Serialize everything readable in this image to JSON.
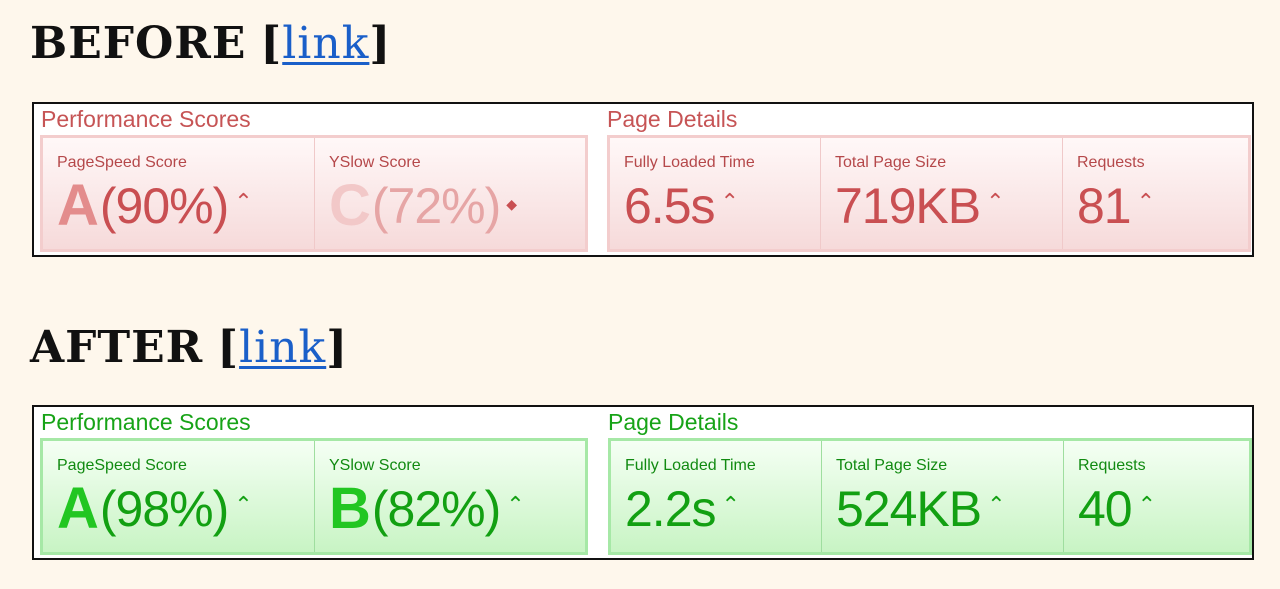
{
  "before": {
    "heading": "BEFORE",
    "link": "link",
    "performance_title": "Performance Scores",
    "details_title": "Page Details",
    "pagespeed": {
      "label": "PageSpeed Score",
      "grade": "A",
      "percent": "(90%)",
      "arrow": "⌃"
    },
    "yslow": {
      "label": "YSlow Score",
      "grade": "C",
      "percent": "(72%)",
      "arrow": "◆"
    },
    "loaded": {
      "label": "Fully Loaded Time",
      "value": "6.5s",
      "arrow": "⌃"
    },
    "size": {
      "label": "Total Page Size",
      "value": "719KB",
      "arrow": "⌃"
    },
    "requests": {
      "label": "Requests",
      "value": "81",
      "arrow": "⌃"
    },
    "colors": {
      "title": "#c65455",
      "value": "#c94f52"
    }
  },
  "after": {
    "heading": "AFTER",
    "link": "link",
    "performance_title": "Performance Scores",
    "details_title": "Page Details",
    "pagespeed": {
      "label": "PageSpeed Score",
      "grade": "A",
      "percent": "(98%)",
      "arrow": "⌃"
    },
    "yslow": {
      "label": "YSlow Score",
      "grade": "B",
      "percent": "(82%)",
      "arrow": "⌃"
    },
    "loaded": {
      "label": "Fully Loaded Time",
      "value": "2.2s",
      "arrow": "⌃"
    },
    "size": {
      "label": "Total Page Size",
      "value": "524KB",
      "arrow": "⌃"
    },
    "requests": {
      "label": "Requests",
      "value": "40",
      "arrow": "⌃"
    },
    "colors": {
      "title": "#17a317",
      "value": "#12a012"
    }
  }
}
